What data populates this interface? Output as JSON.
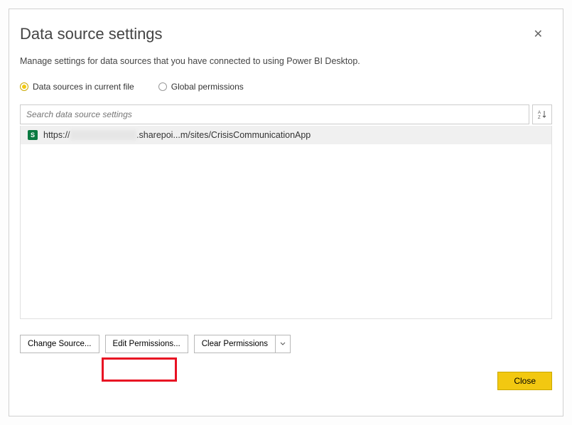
{
  "title": "Data source settings",
  "subtitle": "Manage settings for data sources that you have connected to using Power BI Desktop.",
  "radio": {
    "current_file": "Data sources in current file",
    "global": "Global permissions"
  },
  "search": {
    "placeholder": "Search data source settings"
  },
  "data_sources": [
    {
      "icon": "sharepoint",
      "url_prefix": "https://",
      "url_mid_visible": ".sharepoi...m/sites/CrisisCommunicationApp"
    }
  ],
  "buttons": {
    "change_source": "Change Source...",
    "edit_permissions": "Edit Permissions...",
    "clear_permissions": "Clear Permissions",
    "close": "Close"
  }
}
